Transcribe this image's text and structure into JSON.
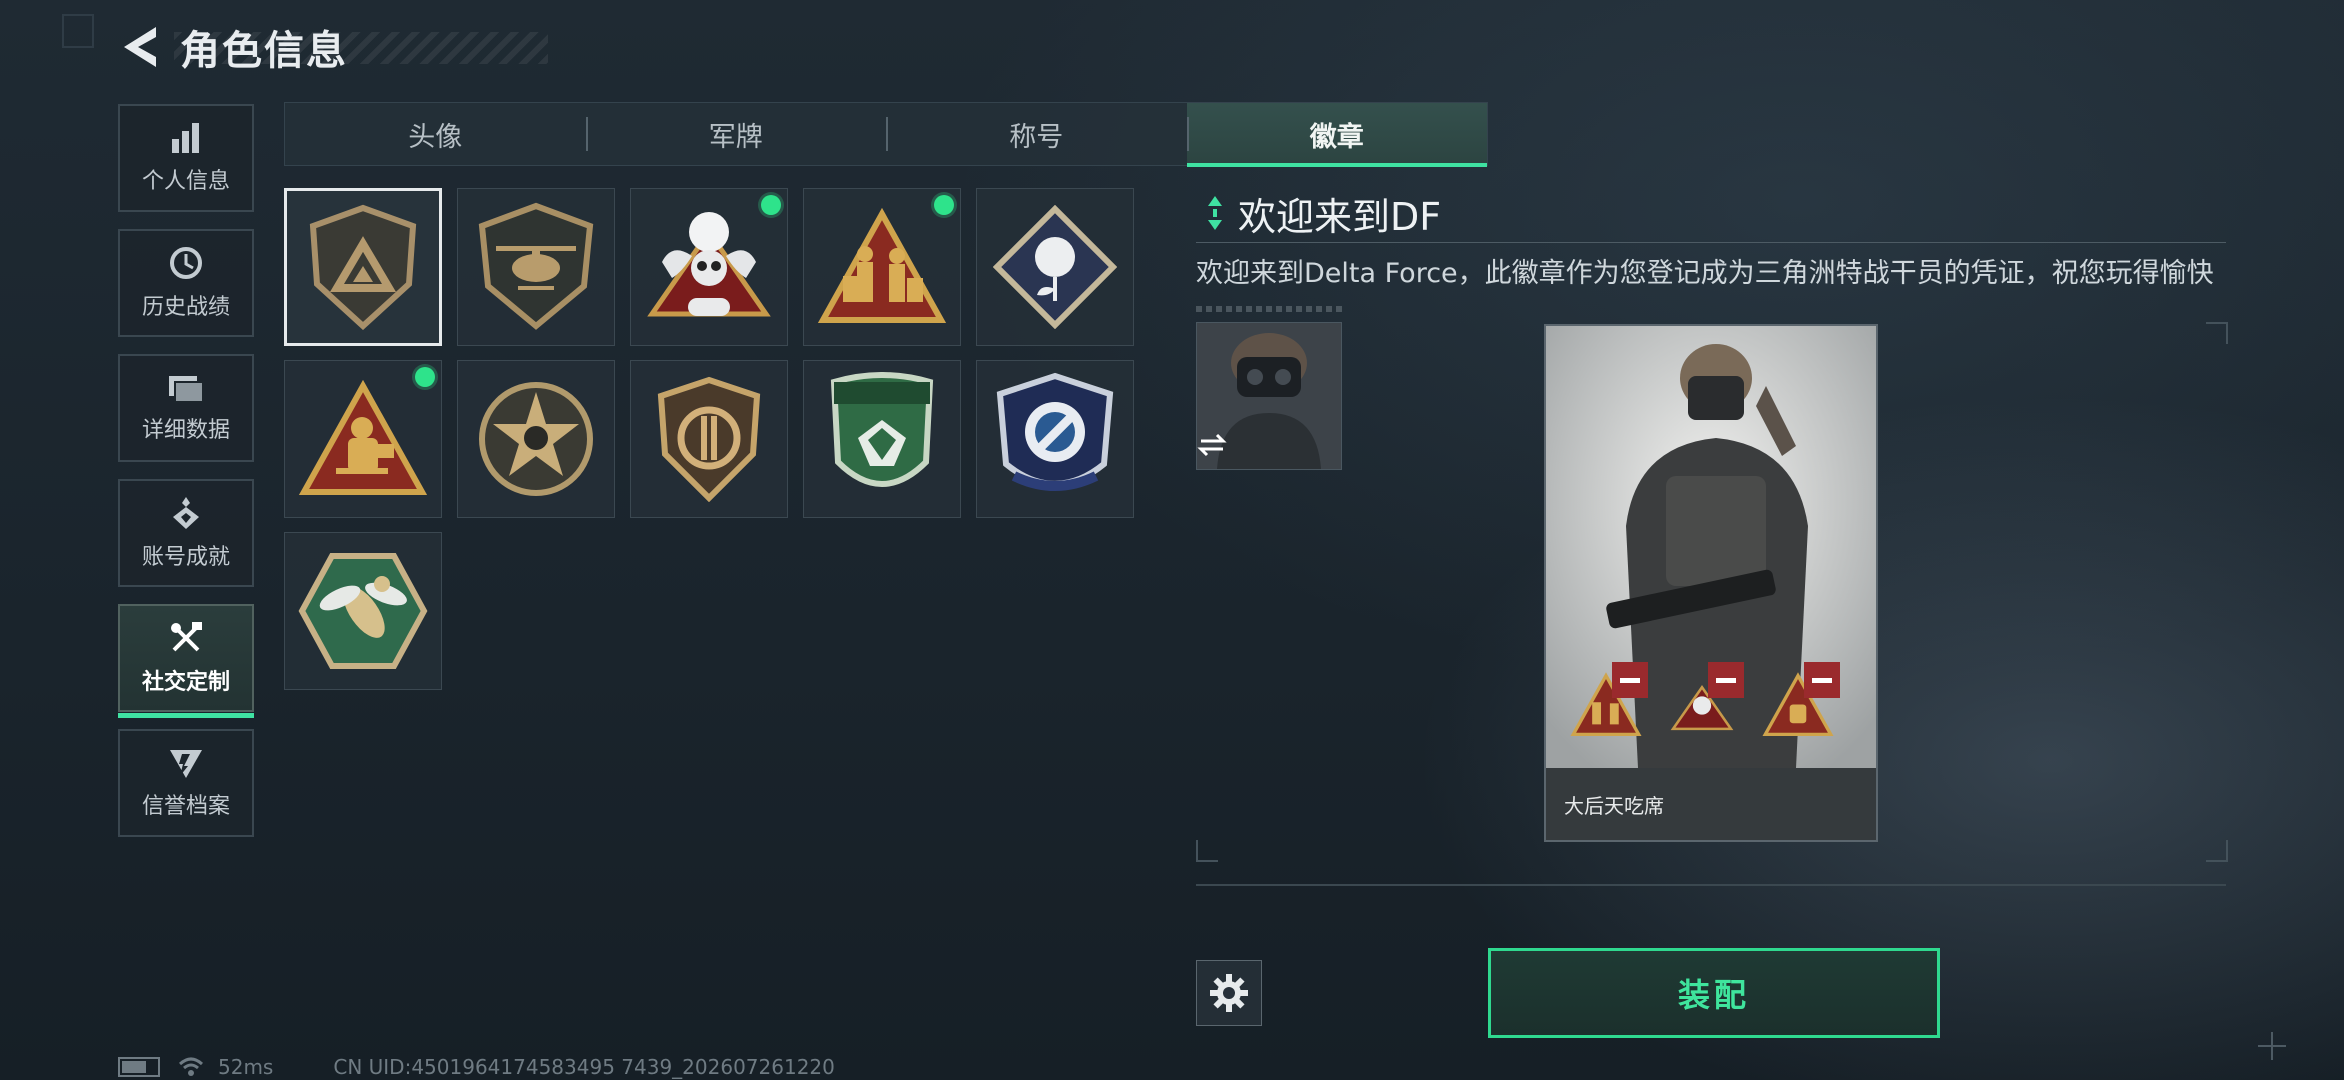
{
  "header": {
    "title": "角色信息"
  },
  "side_nav": [
    {
      "label": "个人信息",
      "icon": "bar-chart-icon"
    },
    {
      "label": "历史战绩",
      "icon": "history-icon"
    },
    {
      "label": "详细数据",
      "icon": "folder-icon"
    },
    {
      "label": "账号成就",
      "icon": "medal-icon"
    },
    {
      "label": "社交定制",
      "icon": "tools-icon",
      "active": true
    },
    {
      "label": "信誉档案",
      "icon": "credit-icon"
    }
  ],
  "tabs": [
    {
      "label": "头像"
    },
    {
      "label": "军牌"
    },
    {
      "label": "称号"
    },
    {
      "label": "徽章",
      "active": true
    }
  ],
  "badges": [
    {
      "name": "delta-badge",
      "selected": true,
      "new": false
    },
    {
      "name": "helicopter-badge",
      "new": false
    },
    {
      "name": "skull-wings-badge",
      "new": true
    },
    {
      "name": "soldiers-triangle-badge",
      "new": true
    },
    {
      "name": "rose-diamond-badge",
      "new": false
    },
    {
      "name": "hazmat-triangle-badge",
      "new": true
    },
    {
      "name": "star-skull-badge",
      "new": false
    },
    {
      "name": "gold-shield-badge",
      "new": false
    },
    {
      "name": "green-gem-badge",
      "new": false
    },
    {
      "name": "blue-crosshair-badge",
      "new": false
    },
    {
      "name": "wasp-hexagon-badge",
      "new": false
    }
  ],
  "detail": {
    "title": "欢迎来到DF",
    "description": "欢迎来到Delta Force，此徽章作为您登记成为三角洲特战干员的凭证，祝您玩得愉快"
  },
  "preview": {
    "player_name": "大后天吃席"
  },
  "buttons": {
    "equip": "装配"
  },
  "status": {
    "ping": "52ms",
    "uid": "CN UID:4501964174583495 7439_202607261220"
  },
  "colors": {
    "accent": "#3fe2a2",
    "new_dot": "#2ee38b",
    "remove": "#9a2a2d"
  }
}
